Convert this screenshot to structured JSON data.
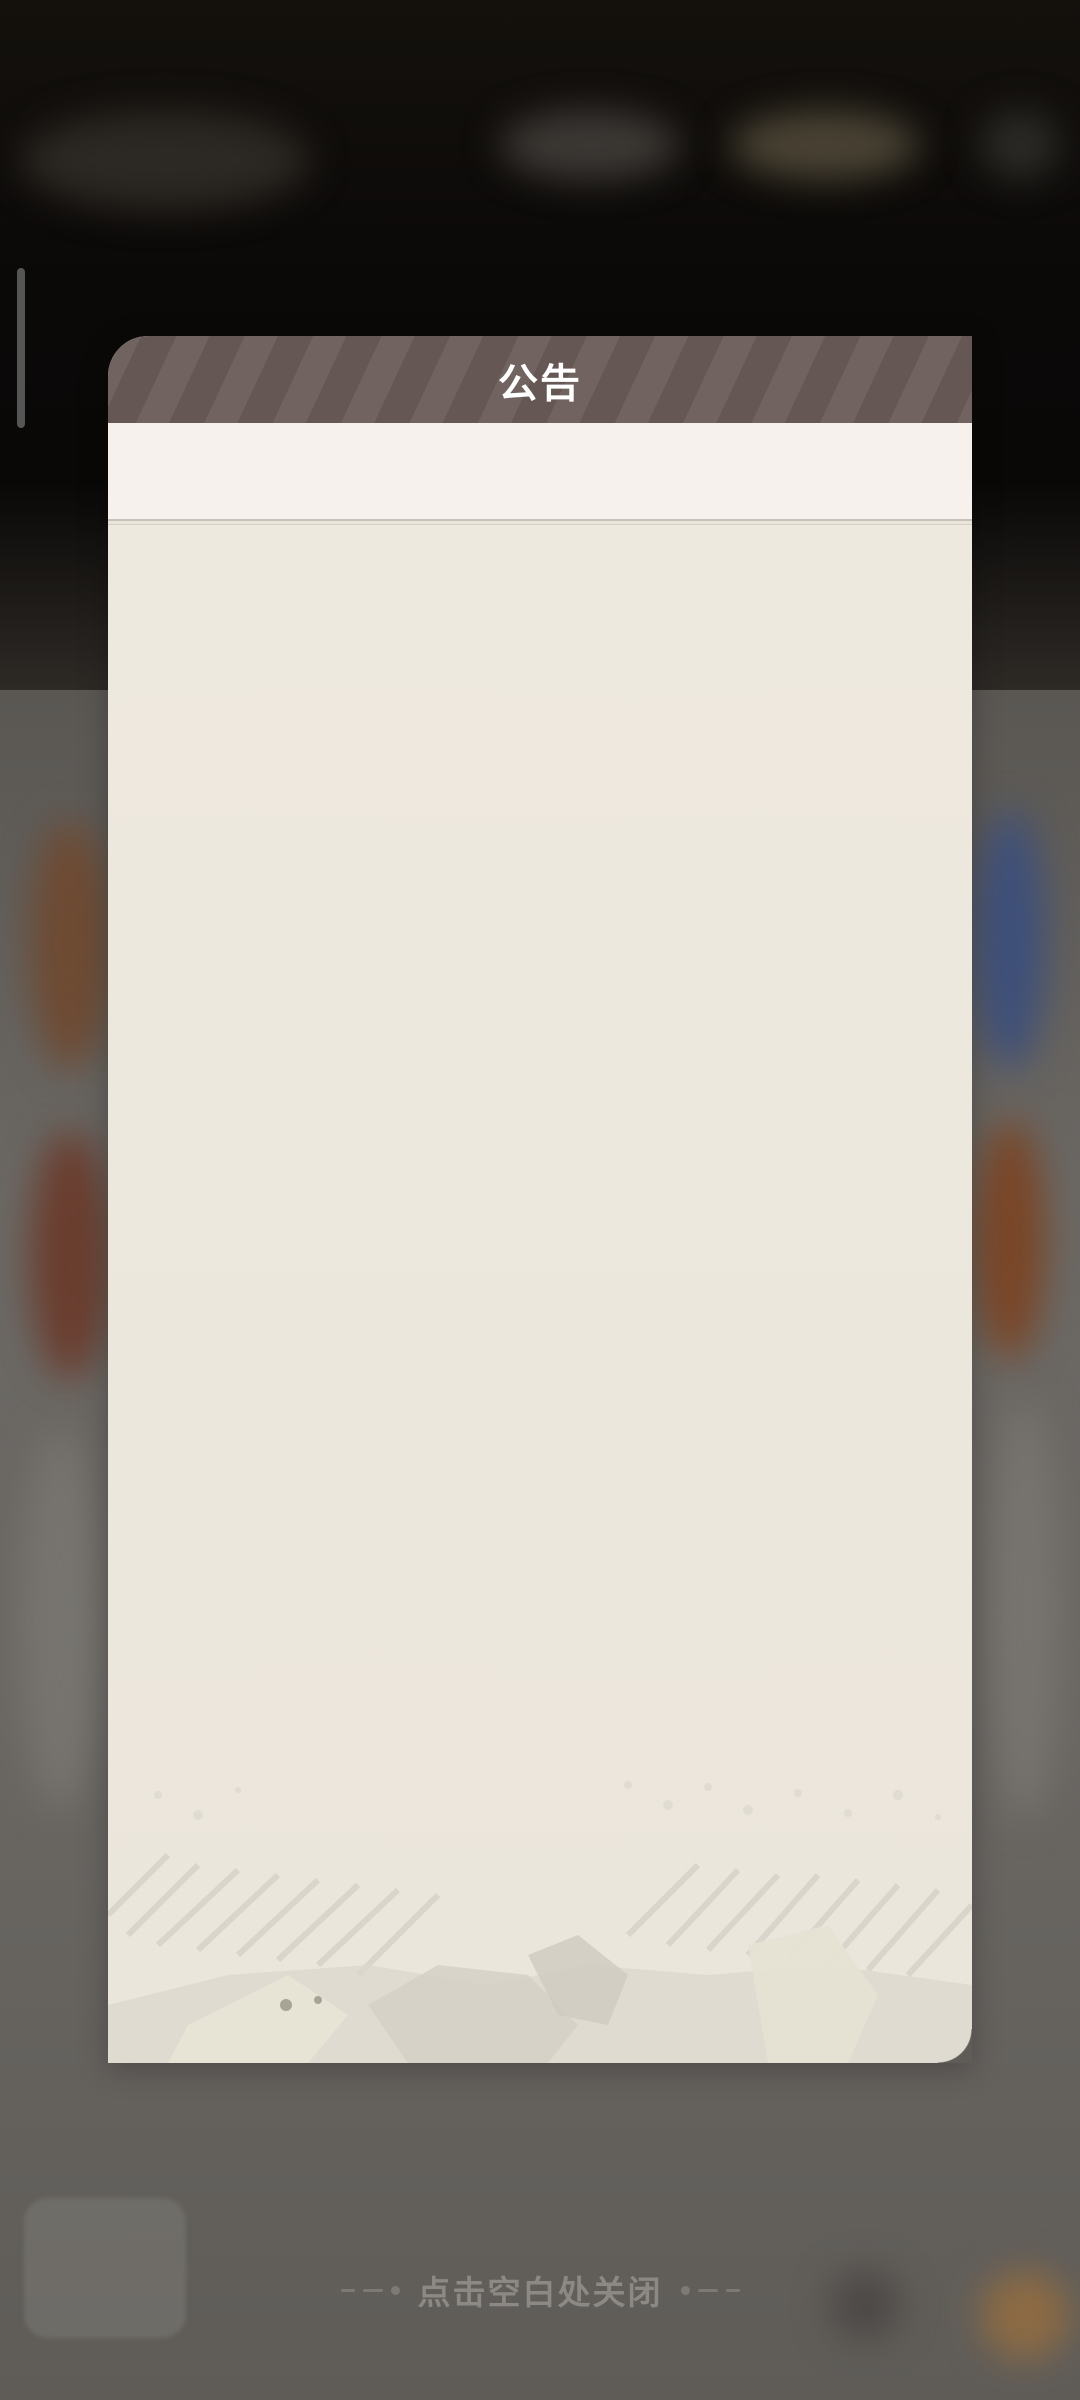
{
  "modal": {
    "title": "公告"
  },
  "hint": {
    "close_text": "点击空白处关闭"
  },
  "colors": {
    "header_bg": "#695b57",
    "body_bg": "#ede8de",
    "subheader_bg": "#f6f1ec",
    "hint_text": "#8c8985"
  }
}
